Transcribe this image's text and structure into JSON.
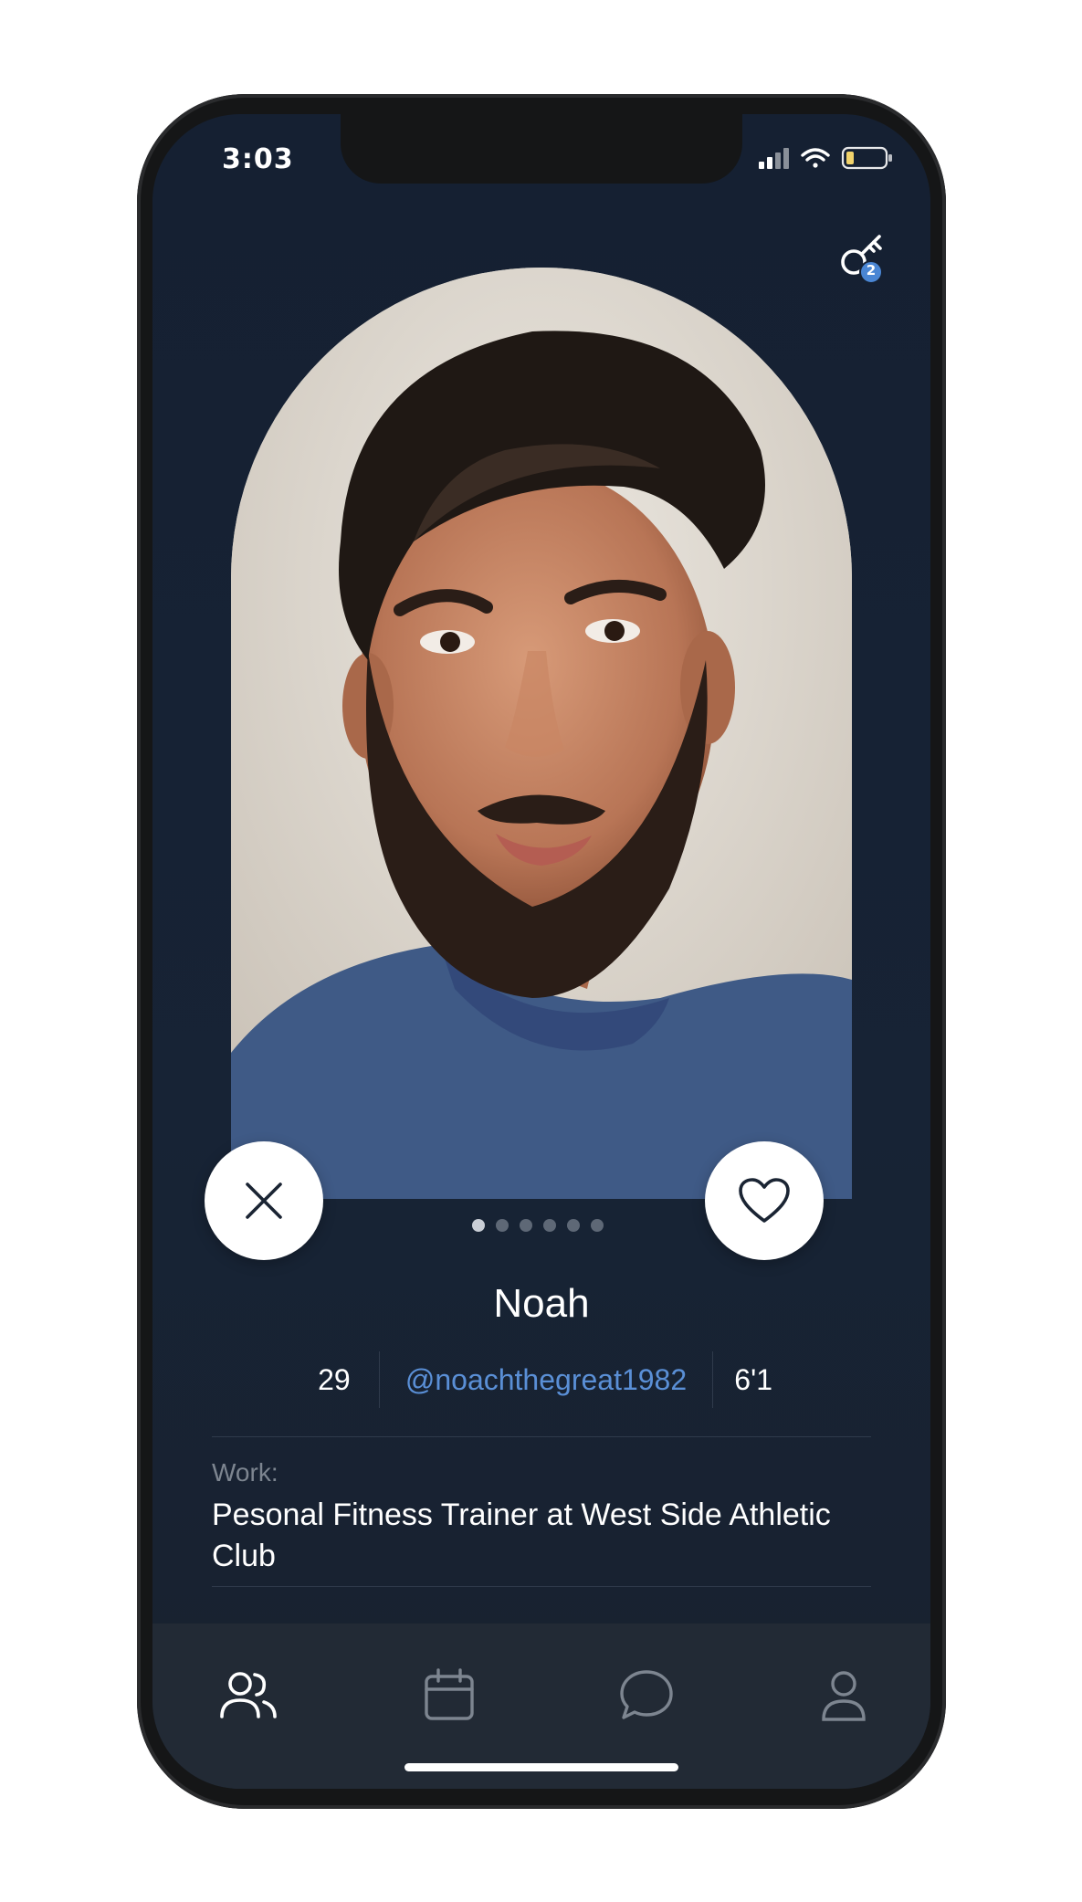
{
  "status_bar": {
    "time": "3:03"
  },
  "keys_badge": {
    "count": "2"
  },
  "profile": {
    "name": "Noah",
    "age": "29",
    "handle": "@noachthegreat1982",
    "height": "6'1",
    "work_label": "Work:",
    "work_value": "Pesonal Fitness Trainer at West Side Athletic Club",
    "photo_count": 6,
    "active_photo_index": 0
  },
  "actions": {
    "dismiss_icon": "close-icon",
    "like_icon": "heart-icon"
  },
  "tabbar": {
    "items": [
      {
        "icon": "people-icon",
        "active": true
      },
      {
        "icon": "calendar-icon",
        "active": false
      },
      {
        "icon": "chat-bubble-icon",
        "active": false
      },
      {
        "icon": "person-icon",
        "active": false
      }
    ]
  },
  "colors": {
    "background": "#152032",
    "accent_blue": "#5a8fd6",
    "tabbar": "#222a35",
    "icon_inactive": "#7d8590"
  }
}
